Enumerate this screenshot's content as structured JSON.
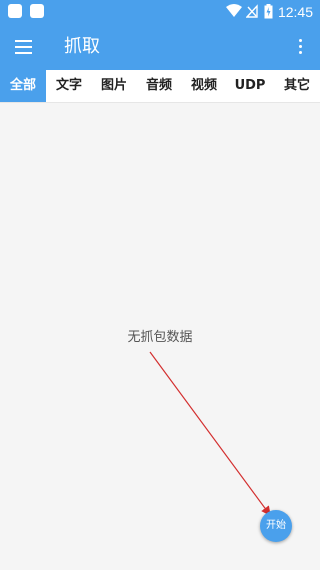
{
  "status_bar": {
    "time": "12:45",
    "icons": [
      "notification-icon",
      "notification-icon",
      "wifi-icon",
      "no-signal-icon",
      "battery-charging-icon"
    ]
  },
  "app_bar": {
    "title": "抓取",
    "menu_icon": "hamburger-menu-icon",
    "overflow_icon": "more-vert-icon"
  },
  "tabs": [
    {
      "label": "全部",
      "active": true
    },
    {
      "label": "文字",
      "active": false
    },
    {
      "label": "图片",
      "active": false
    },
    {
      "label": "音频",
      "active": false
    },
    {
      "label": "视频",
      "active": false
    },
    {
      "label": "UDP",
      "active": false
    },
    {
      "label": "其它",
      "active": false
    }
  ],
  "content": {
    "empty_message": "无抓包数据"
  },
  "fab": {
    "label": "开始"
  },
  "colors": {
    "primary": "#4aa0ec",
    "background": "#f5f5f5",
    "annotation_arrow": "#d32f2f"
  }
}
